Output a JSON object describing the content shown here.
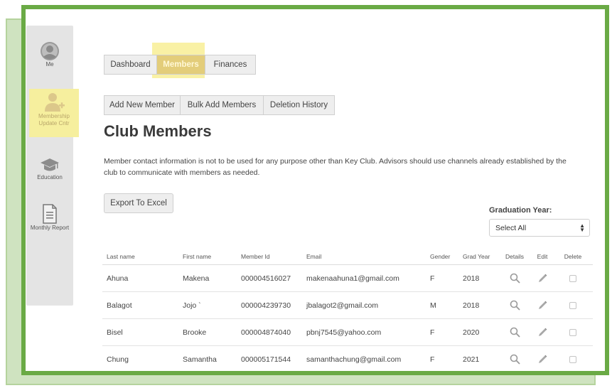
{
  "tabs": [
    {
      "label": "Dashboard",
      "active": false
    },
    {
      "label": "Members",
      "active": true
    },
    {
      "label": "Finances",
      "active": false
    }
  ],
  "sidebar": {
    "items": [
      {
        "label": "Me",
        "icon": "user-circle-icon"
      },
      {
        "label": "Membership Update Cntr",
        "icon": "add-user-icon",
        "highlighted": true
      },
      {
        "label": "Education",
        "icon": "graduation-cap-icon"
      },
      {
        "label": "Monthly Report",
        "icon": "document-icon"
      }
    ]
  },
  "actions": {
    "add_new_member": "Add New Member",
    "bulk_add_members": "Bulk Add Members",
    "deletion_history": "Deletion History",
    "export": "Export To Excel"
  },
  "page": {
    "title": "Club Members",
    "notice": "Member contact information is not to be used for any purpose other than Key Club. Advisors should use channels already established by the club to communicate with members as needed."
  },
  "filter": {
    "label": "Graduation Year:",
    "selected": "Select All"
  },
  "table": {
    "headers": [
      "Last name",
      "First name",
      "Member Id",
      "Email",
      "Gender",
      "Grad Year",
      "Details",
      "Edit",
      "Delete"
    ],
    "rows": [
      {
        "last": "Ahuna",
        "first": "Makena",
        "id": "000004516027",
        "email": "makenaahuna1@gmail.com",
        "gender": "F",
        "year": "2018"
      },
      {
        "last": "Balagot",
        "first": "Jojo `",
        "id": "000004239730",
        "email": "jbalagot2@gmail.com",
        "gender": "M",
        "year": "2018"
      },
      {
        "last": "Bisel",
        "first": "Brooke",
        "id": "000004874040",
        "email": "pbnj7545@yahoo.com",
        "gender": "F",
        "year": "2020"
      },
      {
        "last": "Chung",
        "first": "Samantha",
        "id": "000005171544",
        "email": "samanthachung@gmail.com",
        "gender": "F",
        "year": "2021"
      }
    ]
  },
  "colors": {
    "frame_green": "#6aaa45",
    "highlight_yellow": "#f6ef9e",
    "active_tab": "#e3cd7a"
  }
}
